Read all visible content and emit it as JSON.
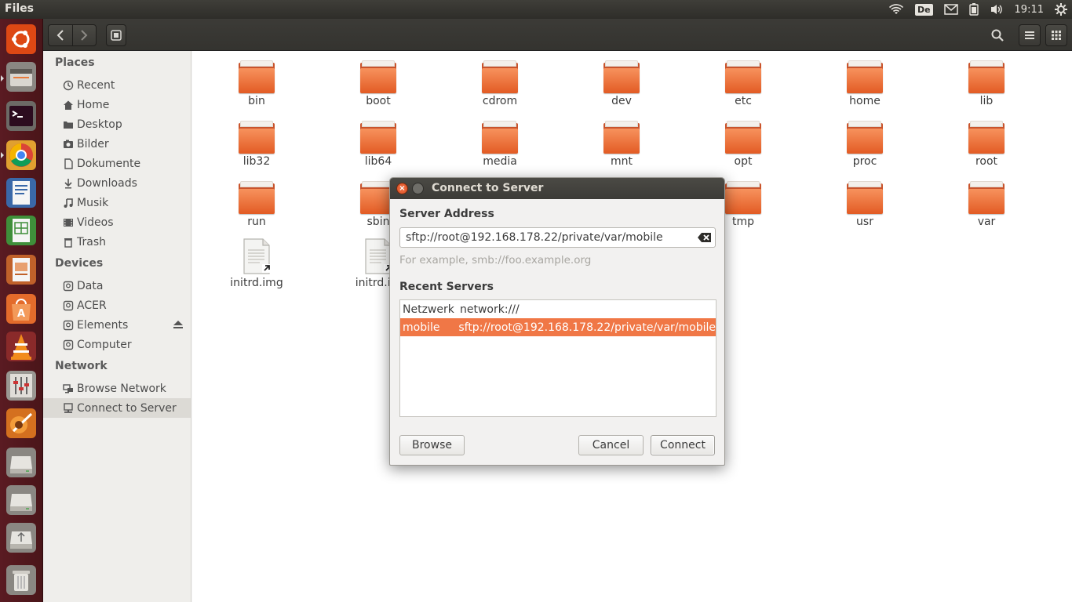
{
  "top_panel": {
    "title": "Files",
    "keyboard_layout": "De",
    "clock": "19:11"
  },
  "launcher": {
    "items": [
      "ubuntu-logo-icon",
      "files-icon",
      "terminal-icon",
      "chrome-icon",
      "writer-icon",
      "calc-icon",
      "impress-icon",
      "software-center-icon",
      "vlc-icon",
      "mixer-icon",
      "app-icon",
      "drive-icon",
      "drive-icon",
      "usb-drive-icon",
      "trash-icon"
    ]
  },
  "sidebar": {
    "places_heading": "Places",
    "places": [
      {
        "label": "Recent",
        "icon": "clock-icon"
      },
      {
        "label": "Home",
        "icon": "home-icon"
      },
      {
        "label": "Desktop",
        "icon": "folder-icon"
      },
      {
        "label": "Bilder",
        "icon": "camera-icon"
      },
      {
        "label": "Dokumente",
        "icon": "document-icon"
      },
      {
        "label": "Downloads",
        "icon": "download-icon"
      },
      {
        "label": "Musik",
        "icon": "music-icon"
      },
      {
        "label": "Videos",
        "icon": "film-icon"
      },
      {
        "label": "Trash",
        "icon": "trash-icon"
      }
    ],
    "devices_heading": "Devices",
    "devices": [
      {
        "label": "Data",
        "icon": "drive-icon"
      },
      {
        "label": "ACER",
        "icon": "drive-icon"
      },
      {
        "label": "Elements",
        "icon": "drive-icon"
      },
      {
        "label": "Computer",
        "icon": "drive-icon"
      }
    ],
    "network_heading": "Network",
    "network": [
      {
        "label": "Browse Network",
        "icon": "network-icon"
      },
      {
        "label": "Connect to Server",
        "icon": "server-icon"
      }
    ]
  },
  "files": [
    {
      "name": "bin",
      "type": "folder"
    },
    {
      "name": "boot",
      "type": "folder"
    },
    {
      "name": "cdrom",
      "type": "folder"
    },
    {
      "name": "dev",
      "type": "folder"
    },
    {
      "name": "etc",
      "type": "folder"
    },
    {
      "name": "home",
      "type": "folder"
    },
    {
      "name": "lib",
      "type": "folder"
    },
    {
      "name": "lib32",
      "type": "folder"
    },
    {
      "name": "lib64",
      "type": "folder"
    },
    {
      "name": "media",
      "type": "folder"
    },
    {
      "name": "mnt",
      "type": "folder"
    },
    {
      "name": "opt",
      "type": "folder"
    },
    {
      "name": "proc",
      "type": "folder"
    },
    {
      "name": "root",
      "type": "folder"
    },
    {
      "name": "run",
      "type": "folder"
    },
    {
      "name": "sbin",
      "type": "folder"
    },
    {
      "name": "tmp",
      "type": "folder"
    },
    {
      "name": "usr",
      "type": "folder"
    },
    {
      "name": "var",
      "type": "folder"
    },
    {
      "name": "initrd.img",
      "type": "file"
    },
    {
      "name": "initrd.im",
      "type": "file"
    }
  ],
  "dialog": {
    "title": "Connect to Server",
    "server_address_label": "Server Address",
    "server_address_value": "sftp://root@192.168.178.22/private/var/mobile",
    "hint": "For example, smb://foo.example.org",
    "recent_label": "Recent Servers",
    "recent_servers": [
      {
        "name": "Netzwerk",
        "uri": "network:///",
        "selected": false
      },
      {
        "name": "mobile",
        "uri": "sftp://root@192.168.178.22/private/var/mobile",
        "selected": true
      }
    ],
    "browse_label": "Browse",
    "cancel_label": "Cancel",
    "connect_label": "Connect"
  }
}
